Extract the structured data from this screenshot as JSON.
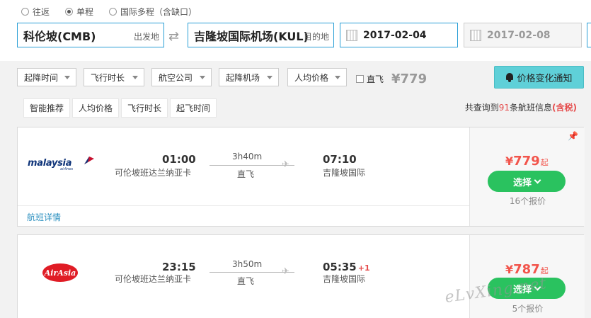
{
  "trip_types": [
    {
      "label": "往返",
      "checked": false
    },
    {
      "label": "单程",
      "checked": true
    },
    {
      "label": "国际多程（含缺口）",
      "checked": false
    }
  ],
  "search": {
    "from_value": "科伦坡(CMB)",
    "from_tag": "出发地",
    "to_value": "吉隆坡国际机场(KUL)",
    "to_tag": "目的地",
    "depart_date": "2017-02-04",
    "return_date": "2017-02-08"
  },
  "filters": {
    "items": [
      "起降时间",
      "飞行时长",
      "航空公司",
      "起降机场",
      "人均价格"
    ],
    "direct_label": "直飞",
    "direct_price": "¥779",
    "notify_label": "价格变化通知"
  },
  "sort": {
    "tabs": [
      "智能推荐",
      "人均价格",
      "飞行时长",
      "起飞时间"
    ],
    "count_prefix": "共查询到",
    "count_number": "91",
    "count_suffix": "条航班信息",
    "tax_note": "(含税)"
  },
  "flights": [
    {
      "airline_logo_text": "malaysia",
      "airline_logo_sub": "airlines",
      "dep_time": "01:00",
      "dep_airport": "可伦坡班达兰纳亚卡",
      "duration": "3h40m",
      "stop_label": "直飞",
      "arr_time": "07:10",
      "arr_day_offset": "",
      "arr_airport": "吉隆坡国际",
      "price_symbol": "¥",
      "price": "779",
      "price_suffix": "起",
      "select_label": "选择",
      "quotes": "16个报价",
      "details_label": "航班详情"
    },
    {
      "airline_logo_text": "AirAsia",
      "dep_time": "23:15",
      "dep_airport": "可伦坡班达兰纳亚卡",
      "duration": "3h50m",
      "stop_label": "直飞",
      "arr_time": "05:35",
      "arr_day_offset": "+1",
      "arr_airport": "吉隆坡国际",
      "price_symbol": "¥",
      "price": "787",
      "price_suffix": "起",
      "select_label": "选择",
      "quotes": "5个报价"
    }
  ],
  "watermark": "eLvXing.net",
  "colors": {
    "accent_blue": "#2a9fd6",
    "price_red": "#f2544b",
    "select_green": "#2ac25f",
    "notify_teal": "#5fd0d8"
  }
}
